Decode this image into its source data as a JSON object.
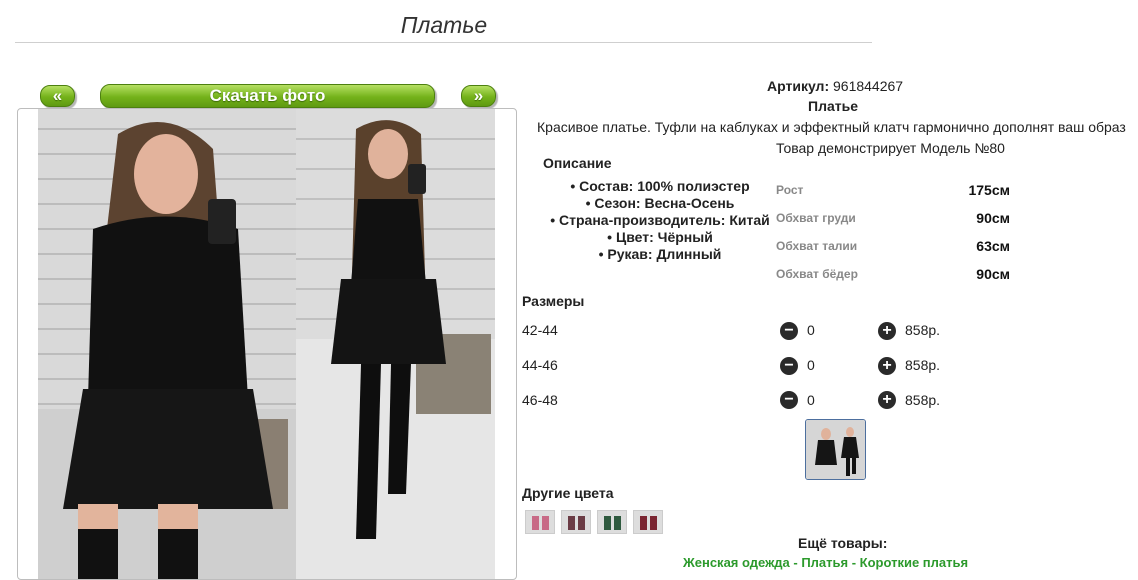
{
  "page_title": "Платье",
  "gallery": {
    "prev_label": "«",
    "download_label": "Скачать фото",
    "next_label": "»"
  },
  "product": {
    "artikul_label": "Артикул:",
    "artikul_value": "961844267",
    "name": "Платье",
    "description": "Красивое платье. Туфли на каблуках и эффектный клатч гармонично дополнят ваш образ",
    "model_note": "Товар демонстрирует Модель №80"
  },
  "specs": {
    "heading": "Описание",
    "items": [
      "Состав: 100% полиэстер",
      "Сезон: Весна-Осень",
      "Страна-производитель: Китай",
      "Цвет: Чёрный",
      "Рукав: Длинный"
    ]
  },
  "measurements": [
    {
      "label": "Рост",
      "value": "175см"
    },
    {
      "label": "Обхват груди",
      "value": "90см"
    },
    {
      "label": "Обхват талии",
      "value": "63см"
    },
    {
      "label": "Обхват бёдер",
      "value": "90см"
    }
  ],
  "sizes": {
    "heading": "Размеры",
    "rows": [
      {
        "size": "42-44",
        "qty": "0",
        "price": "858р."
      },
      {
        "size": "44-46",
        "qty": "0",
        "price": "858р."
      },
      {
        "size": "46-48",
        "qty": "0",
        "price": "858р."
      }
    ],
    "minus_symbol": "−",
    "plus_symbol": "+"
  },
  "other_colors": {
    "heading": "Другие цвета",
    "swatch_colors": [
      "#c86a86",
      "#6b3c45",
      "#2f5a3f",
      "#7a2430"
    ]
  },
  "more_products": {
    "heading": "Ещё товары:",
    "links_text": "Женская одежда - Платья - Короткие платья"
  },
  "colors": {
    "accent_green": "#74b21a",
    "link_green": "#2c9a2c"
  }
}
